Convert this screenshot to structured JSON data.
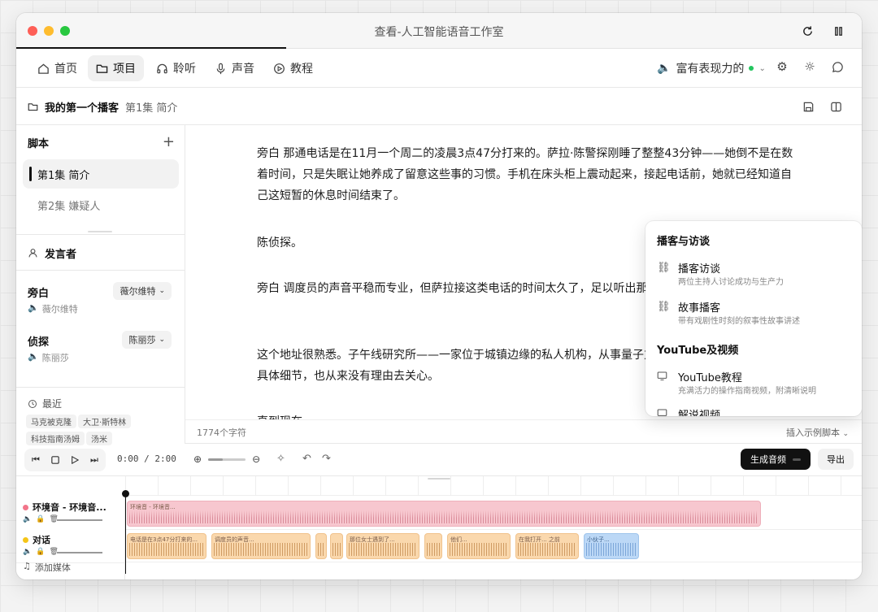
{
  "window": {
    "title": "查看-人工智能语音工作室"
  },
  "nav": {
    "items": [
      {
        "label": "首页",
        "icon": "home-icon"
      },
      {
        "label": "项目",
        "icon": "folder-icon"
      },
      {
        "label": "聆听",
        "icon": "headphones-icon"
      },
      {
        "label": "声音",
        "icon": "microphone-icon"
      },
      {
        "label": "教程",
        "icon": "play-circle-icon"
      }
    ],
    "voice_style": "富有表现力的"
  },
  "breadcrumb": {
    "project": "我的第一个播客",
    "episode": "第1集 简介"
  },
  "sidebar": {
    "script_title": "脚本",
    "episodes": [
      "第1集 简介",
      "第2集 嫌疑人"
    ],
    "speakers_title": "发言者",
    "speakers": [
      {
        "role": "旁白",
        "voice": "薇尔维特",
        "chip": "薇尔维特"
      },
      {
        "role": "侦探",
        "voice": "陈丽莎",
        "chip": "陈丽莎"
      }
    ],
    "recent_title": "最近",
    "recent_tags": [
      "马克被克隆",
      "大卫·斯特林",
      "科技指南汤姆",
      "汤米"
    ]
  },
  "editor": {
    "paragraphs": [
      "旁白 那通电话是在11月一个周二的凌晨3点47分打来的。萨拉·陈警探刚睡了整整43分钟——她倒不是在数着时间，只是失眠让她养成了留意这些事的习惯。手机在床头柜上震动起来，接起电话前，她就已经知道自己这短暂的休息时间结束了。",
      "陈侦探。",
      "旁白 调度员的声音平稳而专业，但萨拉接这类电话的时间太久了，足以听出那是不安，或许甚至是恐惧。",
      "这个地址很熟悉。子午线研究所——一家位于城镇边缘的私人机构，从事量子方面的研究。萨拉从未弄明白具体细节，也从来没有理由去关心。",
      "直到现在。"
    ],
    "char_count": "1774个字符",
    "insert_example": "插入示例脚本"
  },
  "dropdown": {
    "section1": "播客与访谈",
    "items1": [
      {
        "name": "播客访谈",
        "desc": "两位主持人讨论成功与生产力"
      },
      {
        "name": "故事播客",
        "desc": "带有戏剧性时刻的叙事性故事讲述"
      }
    ],
    "section2": "YouTube及视频",
    "items2": [
      {
        "name": "YouTube教程",
        "desc": "充满活力的操作指南视频，附清晰说明"
      },
      {
        "name": "解说视频",
        "desc": ""
      }
    ]
  },
  "transport": {
    "timecode": "0:00 / 2:00",
    "zoom_level": 0.4,
    "generate_label": "生成音频",
    "export_label": "导出"
  },
  "timeline": {
    "tracks": [
      {
        "name": "环境音 - 环境音...",
        "color": "#f2758a"
      },
      {
        "name": "对话",
        "color": "#f5c518"
      }
    ],
    "add_media": "添加媒体",
    "ambient_clip": "环境音 - 环境音...",
    "dialog_clips": [
      "电话是在3点47分打来的...",
      "调度员的声音...",
      "",
      "",
      "那位女士遇到了...",
      "",
      "他们...",
      "在我打开... 之前",
      "小伙子..."
    ]
  },
  "colors": {
    "accent": "#111111",
    "pink": "#f7c7cf",
    "orange": "#fad8ad",
    "blue": "#bcd8f6"
  }
}
